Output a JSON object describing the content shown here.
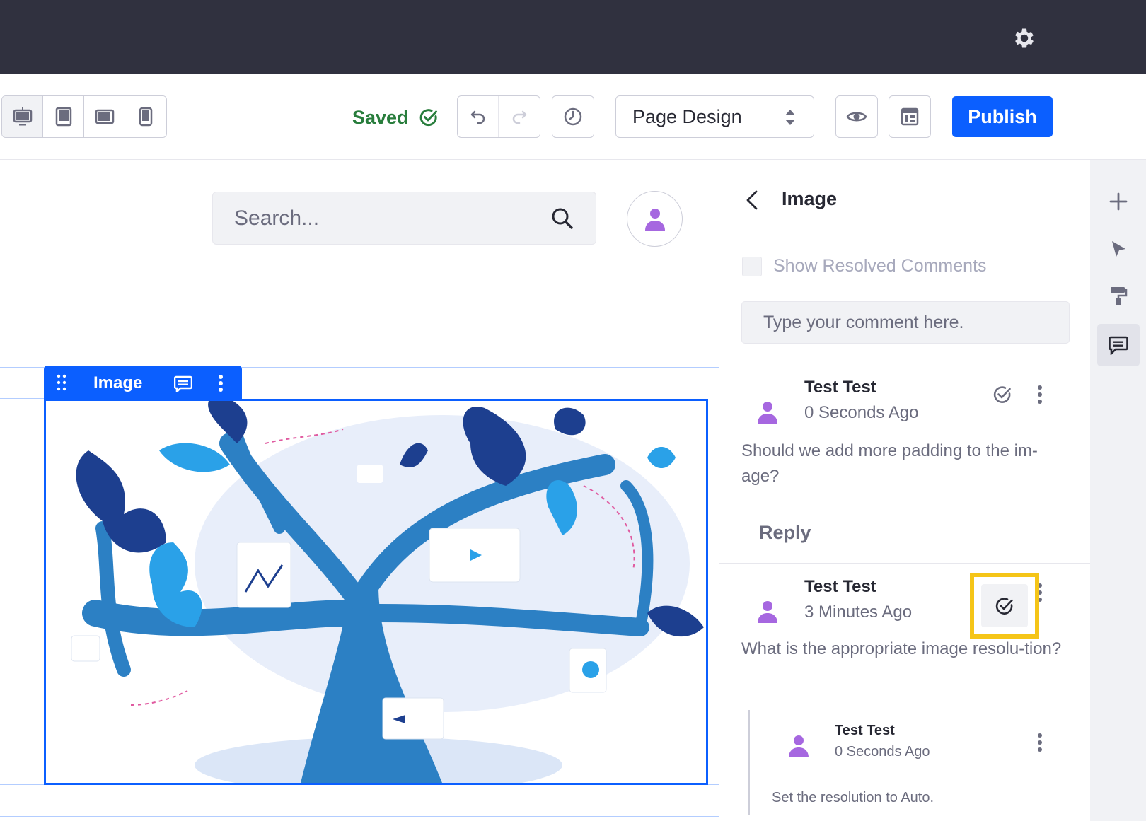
{
  "toolbar": {
    "saved_label": "Saved",
    "page_design_select": "Page Design",
    "publish_label": "Publish",
    "devices": [
      "desktop",
      "tablet",
      "landscape",
      "mobile"
    ]
  },
  "canvas": {
    "search_placeholder": "Search...",
    "fragment_label": "Image"
  },
  "panel": {
    "title": "Image",
    "show_resolved_label": "Show Resolved Comments",
    "comment_placeholder": "Type your comment here.",
    "comments": [
      {
        "author": "Test Test",
        "time": "0 Seconds Ago",
        "body": "Should we add more padding to the im-age?",
        "reply_label": "Reply"
      },
      {
        "author": "Test Test",
        "time": "3 Minutes Ago",
        "body": "What is the appropriate image resolu-tion?",
        "replies": [
          {
            "author": "Test Test",
            "time": "0 Seconds Ago",
            "body": "Set the resolution to Auto."
          }
        ]
      }
    ]
  },
  "colors": {
    "topbar": "#30313f",
    "primary": "#0b5fff",
    "saved": "#287d3c",
    "highlight": "#f5c518",
    "avatar": "#a667e0"
  },
  "icons": [
    "gear-icon",
    "desktop-icon",
    "tablet-icon",
    "landscape-icon",
    "mobile-icon",
    "check-circle-icon",
    "undo-icon",
    "redo-icon",
    "history-icon",
    "caret-double-icon",
    "eye-icon",
    "page-structure-icon",
    "search-icon",
    "user-icon",
    "drag-icon",
    "comment-icon",
    "kebab-icon",
    "chevron-left-icon",
    "plus-icon",
    "cursor-icon",
    "paint-roller-icon",
    "comments-icon"
  ]
}
